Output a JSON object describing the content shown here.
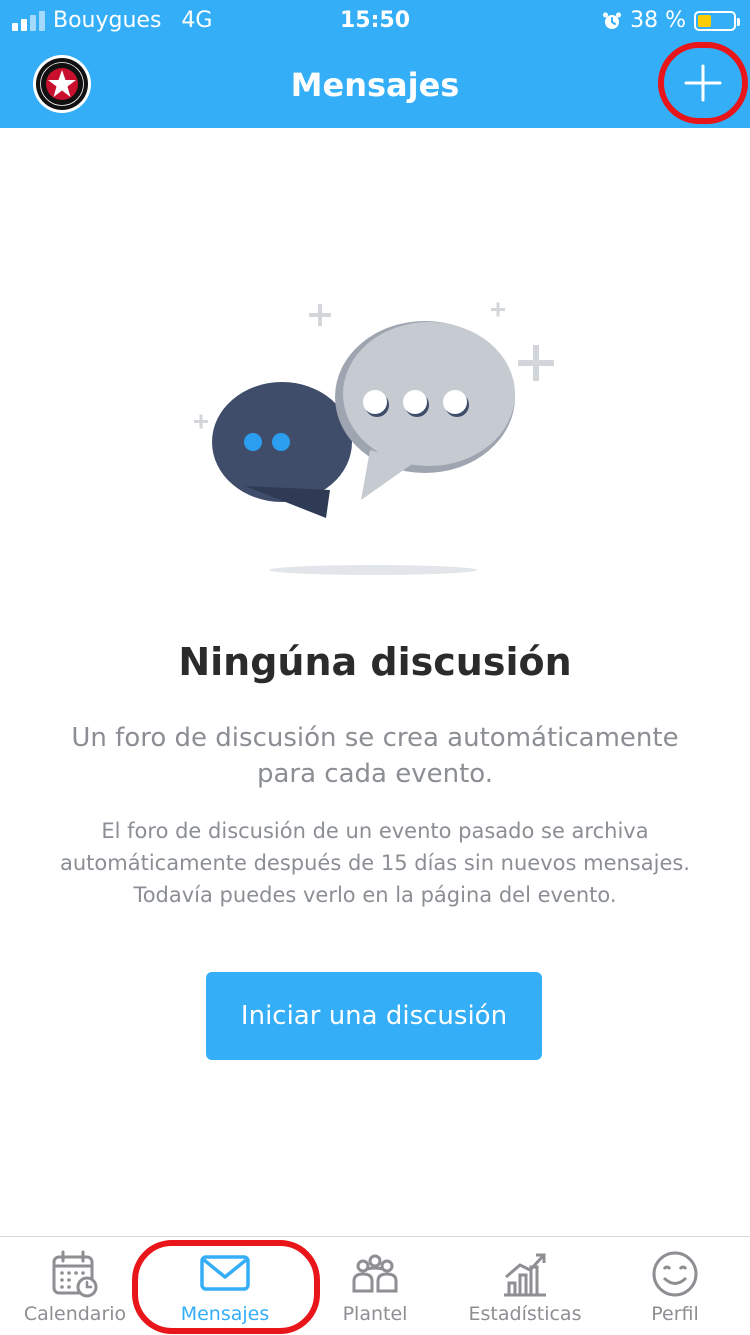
{
  "status_bar": {
    "carrier": "Bouygues",
    "network": "4G",
    "time": "15:50",
    "battery_text": "38 %",
    "battery_level": 0.38
  },
  "header": {
    "title": "Mensajes",
    "logo_icon": "team-crest-icon",
    "add_icon": "plus-icon"
  },
  "empty_state": {
    "title": "Ningúna discusión",
    "description": "Un foro de discusión se crea automáticamente para cada evento.",
    "note": "El foro de discusión de un evento pasado se archiva automáticamente después de 15 días sin nuevos mensajes. Todavía puedes verlo en la página del evento.",
    "button_label": "Iniciar una discusión"
  },
  "tabs": [
    {
      "label": "Calendario",
      "icon": "calendar-icon",
      "active": false
    },
    {
      "label": "Mensajes",
      "icon": "mail-icon",
      "active": true
    },
    {
      "label": "Plantel",
      "icon": "team-icon",
      "active": false
    },
    {
      "label": "Estadísticas",
      "icon": "stats-icon",
      "active": false
    },
    {
      "label": "Perfil",
      "icon": "smiley-icon",
      "active": false
    }
  ],
  "colors": {
    "primary": "#34aef7",
    "highlight": "#e8161a",
    "text_dark": "#2b2b2b",
    "text_muted": "#8b8f94",
    "battery": "#ffcc00"
  }
}
